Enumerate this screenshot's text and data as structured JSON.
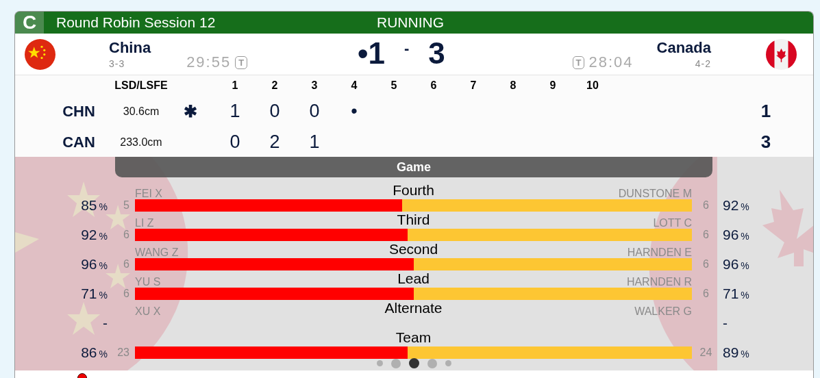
{
  "header": {
    "badge": "C",
    "title": "Round Robin Session 12",
    "status": "RUNNING"
  },
  "teams": [
    {
      "name": "China",
      "record": "3-3",
      "time": "29:55",
      "timeout": "T",
      "kind": "china"
    },
    {
      "name": "Canada",
      "record": "4-2",
      "time": "28:04",
      "timeout": "T",
      "kind": "canada"
    }
  ],
  "score": {
    "home": "•1",
    "separator": "-",
    "away": "3"
  },
  "linescore": {
    "lsd_label": "LSD/LSFE",
    "ends": [
      "1",
      "2",
      "3",
      "4",
      "5",
      "6",
      "7",
      "8",
      "9",
      "10"
    ],
    "rows": [
      {
        "team": "CHN",
        "lsd": "30.6cm",
        "hammer": "✱",
        "ends": [
          "1",
          "0",
          "0",
          "•"
        ],
        "total": "1"
      },
      {
        "team": "CAN",
        "lsd": "233.0cm",
        "ends": [
          "0",
          "2",
          "1"
        ],
        "total": "3"
      }
    ]
  },
  "stats": {
    "title": "Game",
    "rows": [
      {
        "position": "Fourth",
        "home": {
          "player": "FEI X",
          "count": "5",
          "pct": "85",
          "unit": "%"
        },
        "away": {
          "player": "DUNSTONE M",
          "count": "6",
          "pct": "92",
          "unit": "%"
        },
        "level": 0.48
      },
      {
        "position": "Third",
        "home": {
          "player": "LI Z",
          "count": "6",
          "pct": "92",
          "unit": "%"
        },
        "away": {
          "player": "LOTT C",
          "count": "6",
          "pct": "96",
          "unit": "%"
        },
        "level": 0.49
      },
      {
        "position": "Second",
        "home": {
          "player": "WANG Z",
          "count": "6",
          "pct": "96",
          "unit": "%"
        },
        "away": {
          "player": "HARNDEN E",
          "count": "6",
          "pct": "96",
          "unit": "%"
        },
        "level": 0.5
      },
      {
        "position": "Lead",
        "home": {
          "player": "YU S",
          "count": "6",
          "pct": "71",
          "unit": "%"
        },
        "away": {
          "player": "HARNDEN R",
          "count": "6",
          "pct": "71",
          "unit": "%"
        },
        "level": 0.5
      },
      {
        "position": "Alternate",
        "home": {
          "player": "XU X",
          "pct": "-"
        },
        "away": {
          "player": "WALKER G",
          "pct": "-"
        }
      },
      {
        "position": "Team",
        "home": {
          "count": "23",
          "pct": "86",
          "unit": "%"
        },
        "away": {
          "count": "24",
          "pct": "89",
          "unit": "%"
        },
        "level": 0.49
      }
    ]
  },
  "pager": [
    {
      "selected": false
    },
    {
      "selected": false
    },
    {
      "selected": true
    },
    {
      "selected": false
    },
    {
      "selected": false
    }
  ]
}
